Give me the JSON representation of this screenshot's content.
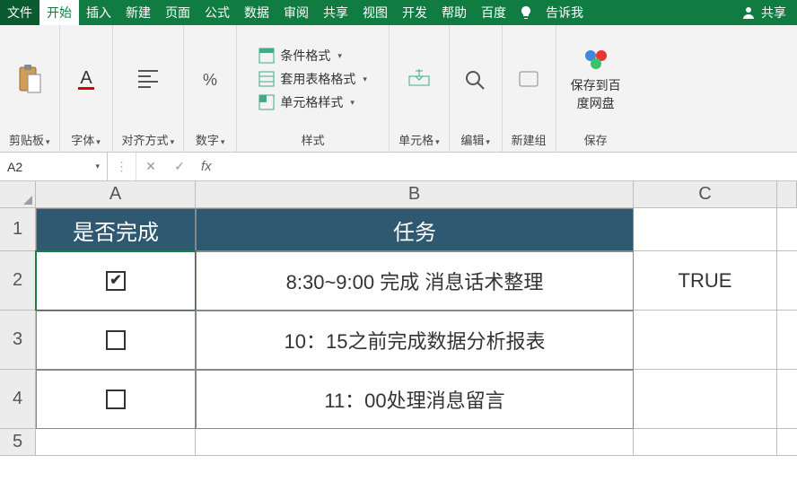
{
  "tabs": {
    "file": "文件",
    "home": "开始",
    "insert": "插入",
    "new": "新建",
    "pagelayout": "页面",
    "formulas": "公式",
    "data": "数据",
    "review": "审阅",
    "share": "共享",
    "view": "视图",
    "developer": "开发",
    "help": "帮助",
    "baidu": "百度",
    "tellme": "告诉我",
    "shareBtn": "共享"
  },
  "ribbon": {
    "clipboard": "剪贴板",
    "font": "字体",
    "alignment": "对齐方式",
    "number": "数字",
    "styles": "样式",
    "cond_fmt": "条件格式",
    "tbl_fmt": "套用表格格式",
    "cell_style": "单元格样式",
    "cells": "单元格",
    "editing": "编辑",
    "newgroup": "新建组",
    "baidu_save": "保存到百度网盘",
    "baidu_grp": "保存"
  },
  "fbar": {
    "name": "A2",
    "fx": "fx",
    "formula": ""
  },
  "cols": {
    "a": "A",
    "b": "B",
    "c": "C"
  },
  "rows": {
    "r1": "1",
    "r2": "2",
    "r3": "3",
    "r4": "4",
    "r5": "5"
  },
  "cells": {
    "a1": "是否完成",
    "b1": "任务",
    "b2": "8:30~9:00 完成 消息话术整理",
    "c2": "TRUE",
    "b3": "10：15之前完成数据分析报表",
    "b4": "11：00处理消息留言",
    "chk2": "✔"
  }
}
